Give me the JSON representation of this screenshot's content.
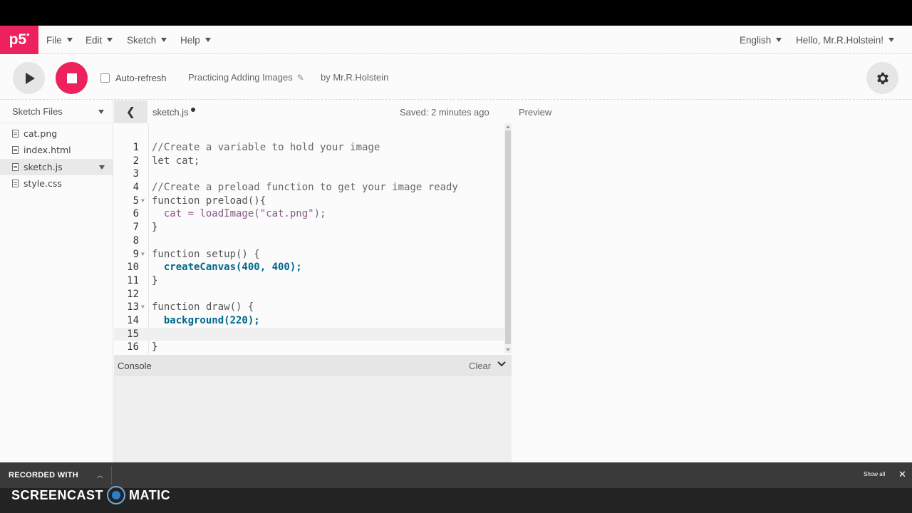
{
  "nav": {
    "logo": "p5",
    "logo_sup": "*",
    "menus": [
      "File",
      "Edit",
      "Sketch",
      "Help"
    ],
    "language": "English",
    "user": "Hello, Mr.R.Holstein!"
  },
  "toolbar": {
    "auto_refresh_label": "Auto-refresh",
    "project_name": "Practicing Adding Images",
    "byline": "by Mr.R.Holstein"
  },
  "sidebar": {
    "title": "Sketch Files",
    "files": [
      "cat.png",
      "index.html",
      "sketch.js",
      "style.css"
    ],
    "selected": "sketch.js"
  },
  "editor": {
    "tab_name": "sketch.js",
    "saved_status": "Saved: 2 minutes ago",
    "lines": [
      {
        "n": "1",
        "text": "//Create a variable to hold your image"
      },
      {
        "n": "2",
        "text": "let cat;"
      },
      {
        "n": "3",
        "text": ""
      },
      {
        "n": "4",
        "text": "//Create a preload function to get your image ready"
      },
      {
        "n": "5",
        "text": "function preload(){"
      },
      {
        "n": "6",
        "text": "  cat = loadImage(\"cat.png\");"
      },
      {
        "n": "7",
        "text": "}"
      },
      {
        "n": "8",
        "text": ""
      },
      {
        "n": "9",
        "text": "function setup() {"
      },
      {
        "n": "10",
        "text": "  createCanvas(400, 400);"
      },
      {
        "n": "11",
        "text": "}"
      },
      {
        "n": "12",
        "text": ""
      },
      {
        "n": "13",
        "text": "function draw() {"
      },
      {
        "n": "14",
        "text": "  background(220);"
      },
      {
        "n": "15",
        "text": ""
      },
      {
        "n": "16",
        "text": "}"
      }
    ]
  },
  "preview": {
    "label": "Preview"
  },
  "console": {
    "label": "Console",
    "clear_label": "Clear"
  },
  "recorder": {
    "label": "RECORDED WITH",
    "show_all": "Show all",
    "brand_left": "SCREENCAST",
    "brand_right": "MATIC"
  },
  "colors": {
    "accent": "#ed225d"
  }
}
